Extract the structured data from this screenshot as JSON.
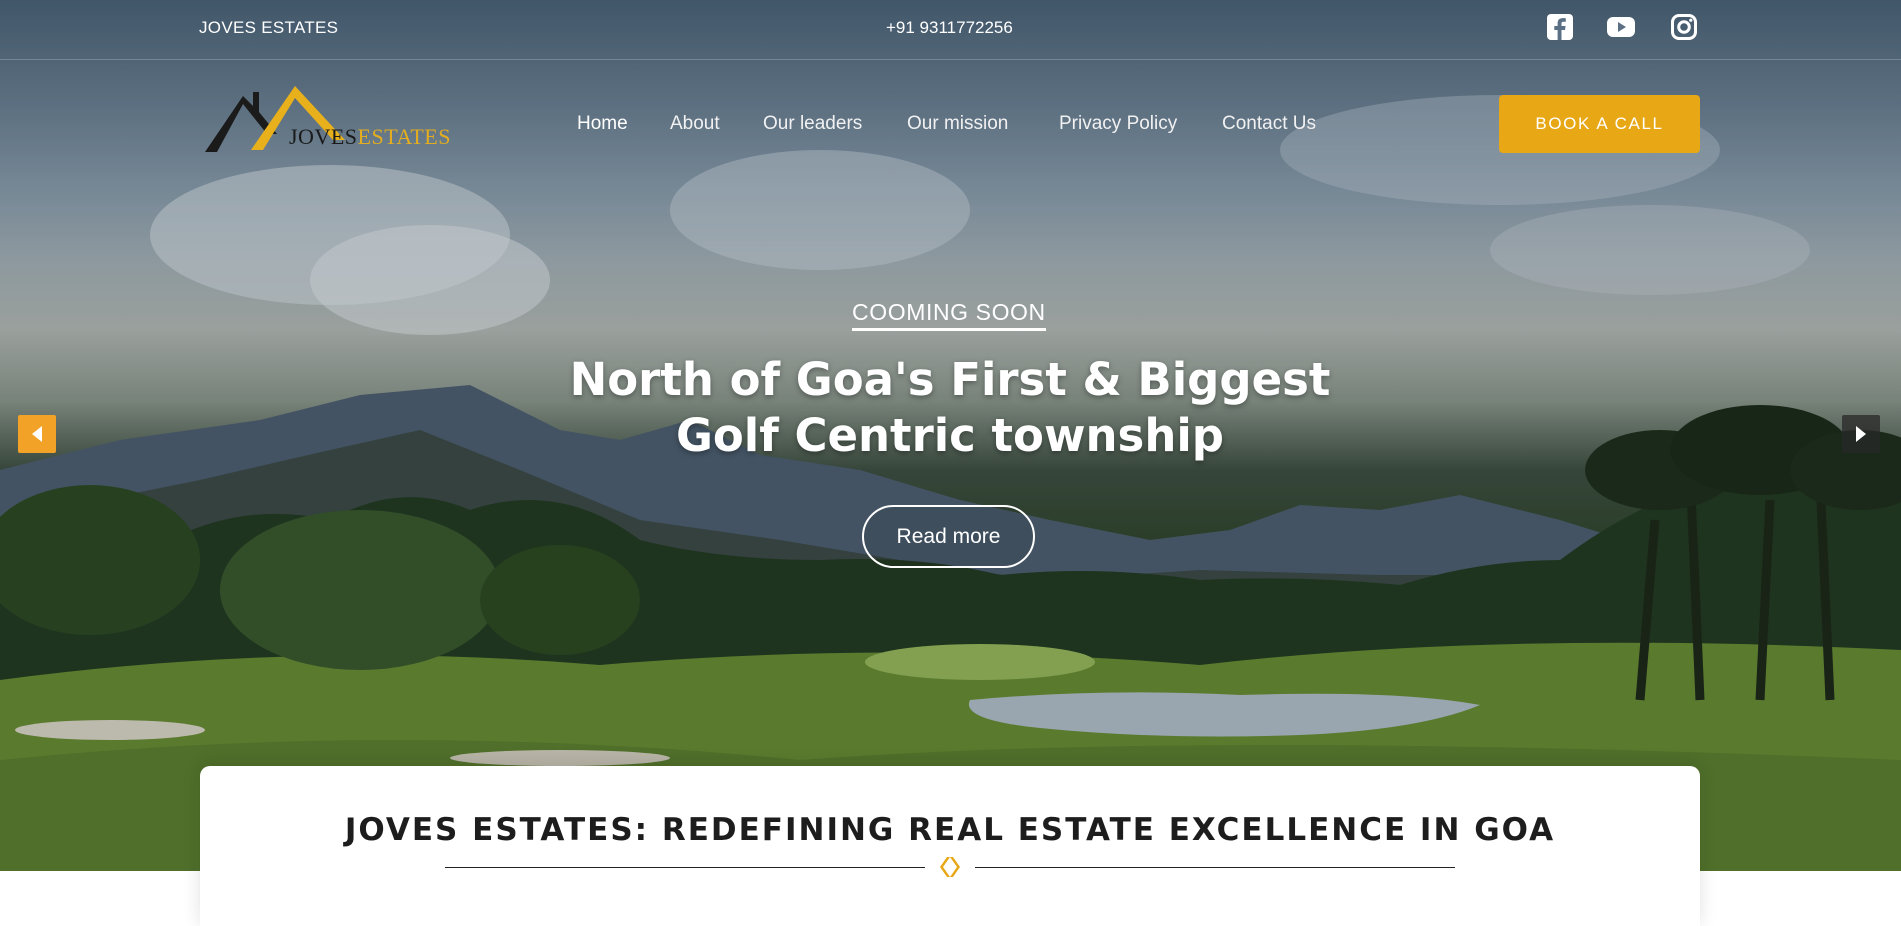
{
  "topbar": {
    "brand": "JOVES ESTATES",
    "phone": "+91 9311772256"
  },
  "social": [
    "facebook-icon",
    "youtube-icon",
    "instagram-icon"
  ],
  "logo": {
    "part1": "JOVES",
    "part2": "ESTATES"
  },
  "nav": [
    {
      "label": "Home",
      "active": true
    },
    {
      "label": "About",
      "active": false
    },
    {
      "label": "Our leaders",
      "active": false
    },
    {
      "label": "Our mission",
      "active": false
    },
    {
      "label": "Privacy Policy",
      "active": false
    },
    {
      "label": "Contact Us",
      "active": false
    }
  ],
  "cta": {
    "book_label": "BOOK A CALL"
  },
  "hero": {
    "eyebrow": "COOMING SOON",
    "headline_line1": "North of Goa's First & Biggest",
    "headline_line2": "Golf Centric township",
    "button_label": "Read more"
  },
  "slider": {
    "prev_icon": "caret-left-icon",
    "next_icon": "caret-right-icon"
  },
  "section": {
    "title": "JOVES ESTATES: REDEFINING REAL ESTATE EXCELLENCE IN GOA"
  },
  "colors": {
    "accent": "#e8a816",
    "arrow_left": "#f2a227",
    "text_dark": "#1d1d1d"
  }
}
